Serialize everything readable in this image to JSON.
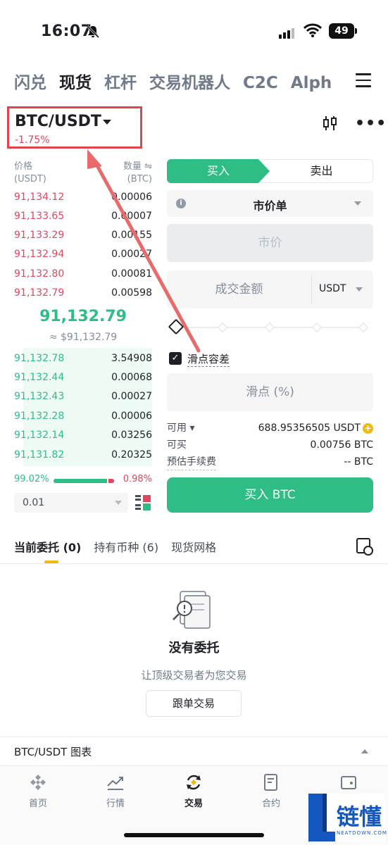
{
  "status_bar": {
    "time": "16:07",
    "battery": "49"
  },
  "top_tabs": [
    "闪兑",
    "现货",
    "杠杆",
    "交易机器人",
    "C2C",
    "Alph"
  ],
  "pair": {
    "name": "BTC/USDT",
    "change": "-1.75%"
  },
  "orderbook": {
    "price_header": "价格",
    "price_unit": "(USDT)",
    "qty_header": "数量 ⇋",
    "qty_unit": "(BTC)",
    "asks": [
      {
        "price": "91,134.12",
        "qty": "0.00006"
      },
      {
        "price": "91,133.65",
        "qty": "0.00007"
      },
      {
        "price": "91,133.29",
        "qty": "0.00155"
      },
      {
        "price": "91,132.94",
        "qty": "0.00027"
      },
      {
        "price": "91,132.80",
        "qty": "0.00081"
      },
      {
        "price": "91,132.79",
        "qty": "0.00598"
      }
    ],
    "last_price": "91,132.79",
    "last_price_usd": "≈ $91,132.79",
    "bids": [
      {
        "price": "91,132.78",
        "qty": "3.54908"
      },
      {
        "price": "91,132.44",
        "qty": "0.00068"
      },
      {
        "price": "91,132.43",
        "qty": "0.00027"
      },
      {
        "price": "91,132.28",
        "qty": "0.00006"
      },
      {
        "price": "91,132.14",
        "qty": "0.03256"
      },
      {
        "price": "91,131.82",
        "qty": "0.20325"
      }
    ],
    "buy_ratio": "99.02%",
    "sell_ratio": "0.98%",
    "precision": "0.01"
  },
  "form": {
    "buy_tab": "买入",
    "sell_tab": "卖出",
    "order_type": "市价单",
    "price_placeholder": "市价",
    "amount_placeholder": "成交金额",
    "amount_unit": "USDT",
    "slippage_label": "滑点容差",
    "slippage_placeholder": "滑点 (%)",
    "available_label": "可用 ▾",
    "available_value": "688.95356505 USDT",
    "can_buy_label": "可买",
    "can_buy_value": "0.00756 BTC",
    "fee_label": "预估手续费",
    "fee_value": "-- BTC",
    "submit": "买入 BTC"
  },
  "order_tabs": [
    "当前委托 (0)",
    "持有币种 (6)",
    "现货网格"
  ],
  "empty": {
    "title": "没有委托",
    "subtitle": "让顶级交易者为您交易",
    "button": "跟单交易"
  },
  "chart_bar": "BTC/USDT 图表",
  "bottom_nav": [
    "首页",
    "行情",
    "交易",
    "合约",
    "资产"
  ],
  "watermark": {
    "text": "链懂",
    "sub": "NEATDOWN.COM"
  },
  "colors": {
    "green": "#2ebd85",
    "red": "#e0465e",
    "accent": "#f0b90b",
    "highlight_box": "#e3434b"
  }
}
